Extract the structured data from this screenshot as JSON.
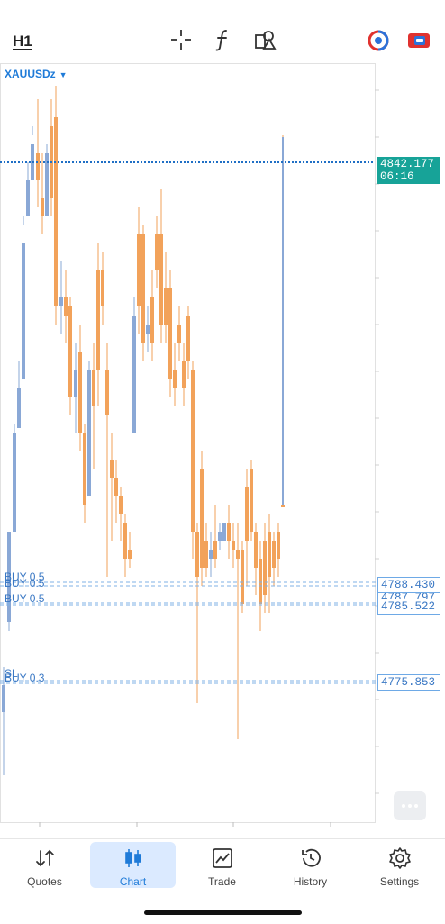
{
  "toolbar": {
    "timeframe": "H1",
    "tools": [
      "crosshair-icon",
      "indicators-icon",
      "objects-icon"
    ],
    "account_icons": [
      "account-switch-icon",
      "one-click-trading-icon"
    ]
  },
  "chart": {
    "symbol": "XAUUSDz",
    "current_price": "4842.177",
    "countdown": "06:16",
    "orders": [
      {
        "label": "BUY 0.5",
        "price": "4788.430"
      },
      {
        "label": "BUY 0.5",
        "price": "4787.797"
      },
      {
        "label": "BUY 0.5",
        "price": "4785.522"
      },
      {
        "label": "SL",
        "price": "4775.853"
      },
      {
        "label": "BUY 0.3",
        "price": "4775.853"
      }
    ],
    "colors": {
      "bull": "#8aa8d6",
      "bear": "#f2a25a",
      "accent": "#1f7bd8",
      "current_line": "#1f6fc5",
      "current_tag": "#17a398"
    }
  },
  "nav": {
    "items": [
      {
        "label": "Quotes",
        "icon": "quotes-icon"
      },
      {
        "label": "Chart",
        "icon": "chart-icon"
      },
      {
        "label": "Trade",
        "icon": "trade-icon"
      },
      {
        "label": "History",
        "icon": "history-icon"
      },
      {
        "label": "Settings",
        "icon": "settings-icon"
      }
    ],
    "active": "Chart"
  }
}
